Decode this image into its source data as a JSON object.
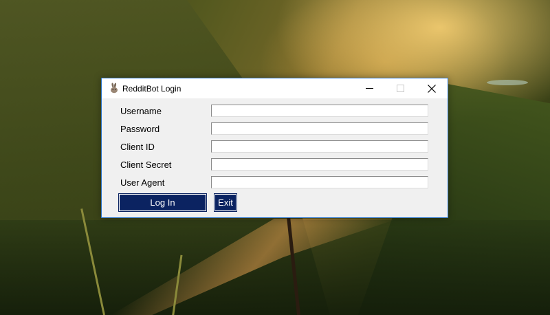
{
  "window": {
    "title": "RedditBot Login",
    "icon": "rabbit-icon"
  },
  "title_buttons": {
    "minimize_icon": "minimize-icon",
    "maximize_icon": "maximize-icon",
    "close_icon": "close-icon"
  },
  "form": {
    "fields": [
      {
        "label": "Username",
        "value": "",
        "placeholder": ""
      },
      {
        "label": "Password",
        "value": "",
        "placeholder": ""
      },
      {
        "label": "Client ID",
        "value": "",
        "placeholder": ""
      },
      {
        "label": "Client Secret",
        "value": "",
        "placeholder": ""
      },
      {
        "label": "User Agent",
        "value": "",
        "placeholder": ""
      }
    ]
  },
  "buttons": {
    "login_label": "Log In",
    "exit_label": "Exit"
  },
  "colors": {
    "button_bg": "#0b2361",
    "window_border": "#2b74c8",
    "window_bg": "#f0f0f0"
  }
}
